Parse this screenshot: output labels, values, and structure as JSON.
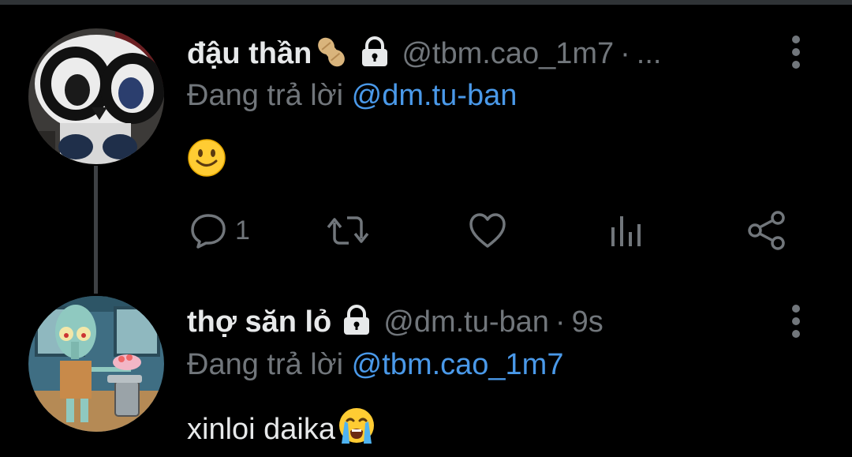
{
  "colors": {
    "background": "#000000",
    "primary_text": "#e7e9ea",
    "secondary_text": "#71767b",
    "link": "#4a99e9",
    "thread_line": "#3e4144"
  },
  "tweets": [
    {
      "display_name": "đậu thần",
      "name_emoji": "peanut-emoji",
      "protected_icon": "lock-icon",
      "handle": "@tbm.cao_1m7",
      "separator": "·",
      "time": "...",
      "reply_prefix": "Đang trả lời",
      "reply_to": "@dm.tu-ban",
      "body_text": "",
      "body_emoji": "slightly-smiling-face-emoji",
      "actions": {
        "reply_count": "1",
        "icons": [
          "reply-icon",
          "retweet-icon",
          "like-icon",
          "analytics-icon",
          "share-icon"
        ]
      }
    },
    {
      "display_name": "thợ săn lỏ",
      "protected_icon": "lock-icon",
      "handle": "@dm.tu-ban",
      "separator": "·",
      "time": "9s",
      "reply_prefix": "Đang trả lời",
      "reply_to": "@tbm.cao_1m7",
      "body_text": "xinloi daika",
      "body_emoji": "loudly-crying-face-emoji"
    }
  ]
}
